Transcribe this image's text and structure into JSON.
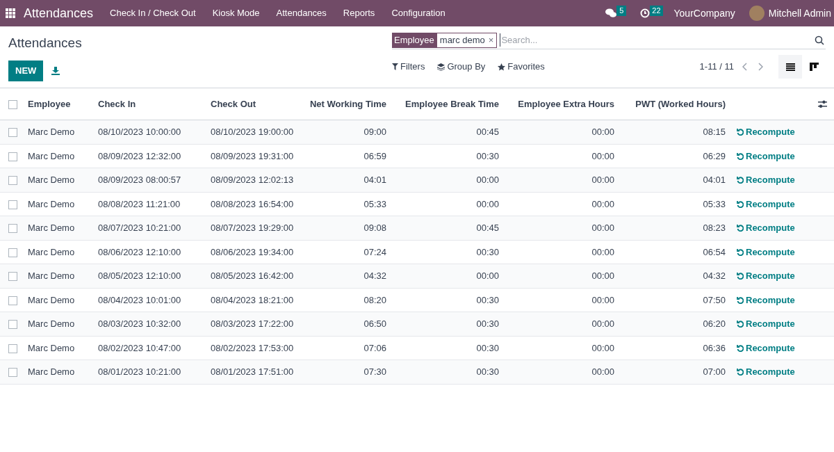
{
  "navbar": {
    "app_name": "Attendances",
    "menu": [
      "Check In / Check Out",
      "Kiosk Mode",
      "Attendances",
      "Reports",
      "Configuration"
    ],
    "messages_count": "5",
    "activities_count": "22",
    "company": "YourCompany",
    "user": "Mitchell Admin"
  },
  "page_title": "Attendances",
  "new_button": "NEW",
  "search": {
    "facet_label": "Employee",
    "facet_value": "marc demo",
    "facet_remove": "×",
    "placeholder": "Search..."
  },
  "filters": [
    "Filters",
    "Group By",
    "Favorites"
  ],
  "pager": "1-11 / 11",
  "views": [
    {
      "kind": "list",
      "selected": true
    },
    {
      "kind": "kanban",
      "selected": false
    }
  ],
  "table": {
    "select_all_checked": false,
    "columns": [
      "Employee",
      "Check In",
      "Check Out",
      "Net Working Time",
      "Employee Break Time",
      "Employee Extra Hours",
      "PWT (Worked Hours)"
    ],
    "rows": [
      {
        "checked": false,
        "cells": [
          "Marc Demo",
          "08/10/2023 10:00:00",
          "08/10/2023 19:00:00",
          "09:00",
          "00:45",
          "00:00",
          "08:15"
        ],
        "action": "Recompute"
      },
      {
        "checked": false,
        "cells": [
          "Marc Demo",
          "08/09/2023 12:32:00",
          "08/09/2023 19:31:00",
          "06:59",
          "00:30",
          "00:00",
          "06:29"
        ],
        "action": "Recompute"
      },
      {
        "checked": false,
        "cells": [
          "Marc Demo",
          "08/09/2023 08:00:57",
          "08/09/2023 12:02:13",
          "04:01",
          "00:00",
          "00:00",
          "04:01"
        ],
        "action": "Recompute"
      },
      {
        "checked": false,
        "cells": [
          "Marc Demo",
          "08/08/2023 11:21:00",
          "08/08/2023 16:54:00",
          "05:33",
          "00:00",
          "00:00",
          "05:33"
        ],
        "action": "Recompute"
      },
      {
        "checked": false,
        "cells": [
          "Marc Demo",
          "08/07/2023 10:21:00",
          "08/07/2023 19:29:00",
          "09:08",
          "00:45",
          "00:00",
          "08:23"
        ],
        "action": "Recompute"
      },
      {
        "checked": false,
        "cells": [
          "Marc Demo",
          "08/06/2023 12:10:00",
          "08/06/2023 19:34:00",
          "07:24",
          "00:30",
          "00:00",
          "06:54"
        ],
        "action": "Recompute"
      },
      {
        "checked": false,
        "cells": [
          "Marc Demo",
          "08/05/2023 12:10:00",
          "08/05/2023 16:42:00",
          "04:32",
          "00:00",
          "00:00",
          "04:32"
        ],
        "action": "Recompute"
      },
      {
        "checked": false,
        "cells": [
          "Marc Demo",
          "08/04/2023 10:01:00",
          "08/04/2023 18:21:00",
          "08:20",
          "00:30",
          "00:00",
          "07:50"
        ],
        "action": "Recompute"
      },
      {
        "checked": false,
        "cells": [
          "Marc Demo",
          "08/03/2023 10:32:00",
          "08/03/2023 17:22:00",
          "06:50",
          "00:30",
          "00:00",
          "06:20"
        ],
        "action": "Recompute"
      },
      {
        "checked": false,
        "cells": [
          "Marc Demo",
          "08/02/2023 10:47:00",
          "08/02/2023 17:53:00",
          "07:06",
          "00:30",
          "00:00",
          "06:36"
        ],
        "action": "Recompute"
      },
      {
        "checked": false,
        "cells": [
          "Marc Demo",
          "08/01/2023 10:21:00",
          "08/01/2023 17:51:00",
          "07:30",
          "00:30",
          "00:00",
          "07:00"
        ],
        "action": "Recompute"
      }
    ]
  }
}
